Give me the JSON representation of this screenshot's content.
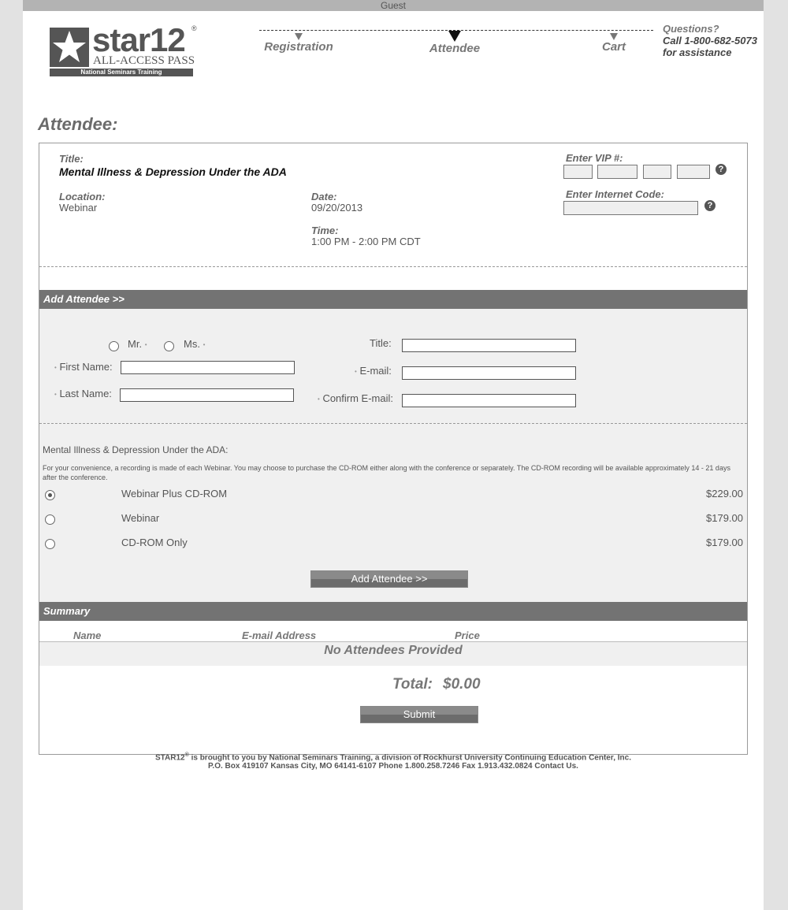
{
  "guest_bar": "Guest",
  "logo": {
    "wordmark": "star12",
    "reg": "®",
    "subtitle": "ALL-ACCESS PASS",
    "bar_text": "National Seminars Training"
  },
  "steps": [
    {
      "label": "Registration"
    },
    {
      "label": "Attendee",
      "active": true
    },
    {
      "label": "Cart"
    }
  ],
  "questions": {
    "line1": "Questions?",
    "line2": "Call 1-800-682-5073",
    "line3": "for assistance"
  },
  "page_title": "Attendee:",
  "event": {
    "title_label": "Title:",
    "title": "Mental Illness & Depression Under the ADA",
    "location_label": "Location:",
    "location": "Webinar",
    "date_label": "Date:",
    "date": "09/20/2013",
    "time_label": "Time:",
    "time": "1:00 PM - 2:00 PM CDT",
    "vip_label": "Enter VIP #:",
    "internet_code_label": "Enter Internet Code:",
    "help_glyph": "?"
  },
  "add_attendee": {
    "header": "Add Attendee >>",
    "salutation_mr": "Mr.",
    "salutation_ms": "Ms.",
    "first_name_label": "First Name:",
    "last_name_label": "Last Name:",
    "title_label": "Title:",
    "email_label": "E-mail:",
    "confirm_email_label": "Confirm E-mail:",
    "required_mark": "•"
  },
  "product": {
    "heading": "Mental Illness & Depression Under the ADA:",
    "note": "For your convenience, a recording is made of each Webinar. You may choose to purchase the CD-ROM either along with the conference or separately. The CD-ROM recording will be available approximately 14 - 21 days after the conference.",
    "options": [
      {
        "label": "Webinar Plus CD-ROM",
        "price": "$229.00",
        "selected": true
      },
      {
        "label": "Webinar",
        "price": "$179.00",
        "selected": false
      },
      {
        "label": "CD-ROM Only",
        "price": "$179.00",
        "selected": false
      }
    ],
    "add_button": "Add Attendee >>"
  },
  "summary": {
    "header": "Summary",
    "col_name": "Name",
    "col_email": "E-mail Address",
    "col_price": "Price",
    "empty_text": "No Attendees Provided",
    "total_label": "Total:",
    "total_value": "$0.00",
    "submit": "Submit"
  },
  "footer": {
    "line1_brand": "STAR12",
    "line1_reg": "®",
    "line1_rest": " is brought to you by National Seminars Training, a division of Rockhurst University Continuing Education Center, Inc.",
    "line2": "P.O. Box 419107 Kansas City, MO 64141-6107 Phone 1.800.258.7246 Fax 1.913.432.0824 Contact Us."
  },
  "colors": {
    "section_bar": "#737373",
    "page_bg": "#e2e2e2",
    "gray_area": "#f0f0f0"
  }
}
